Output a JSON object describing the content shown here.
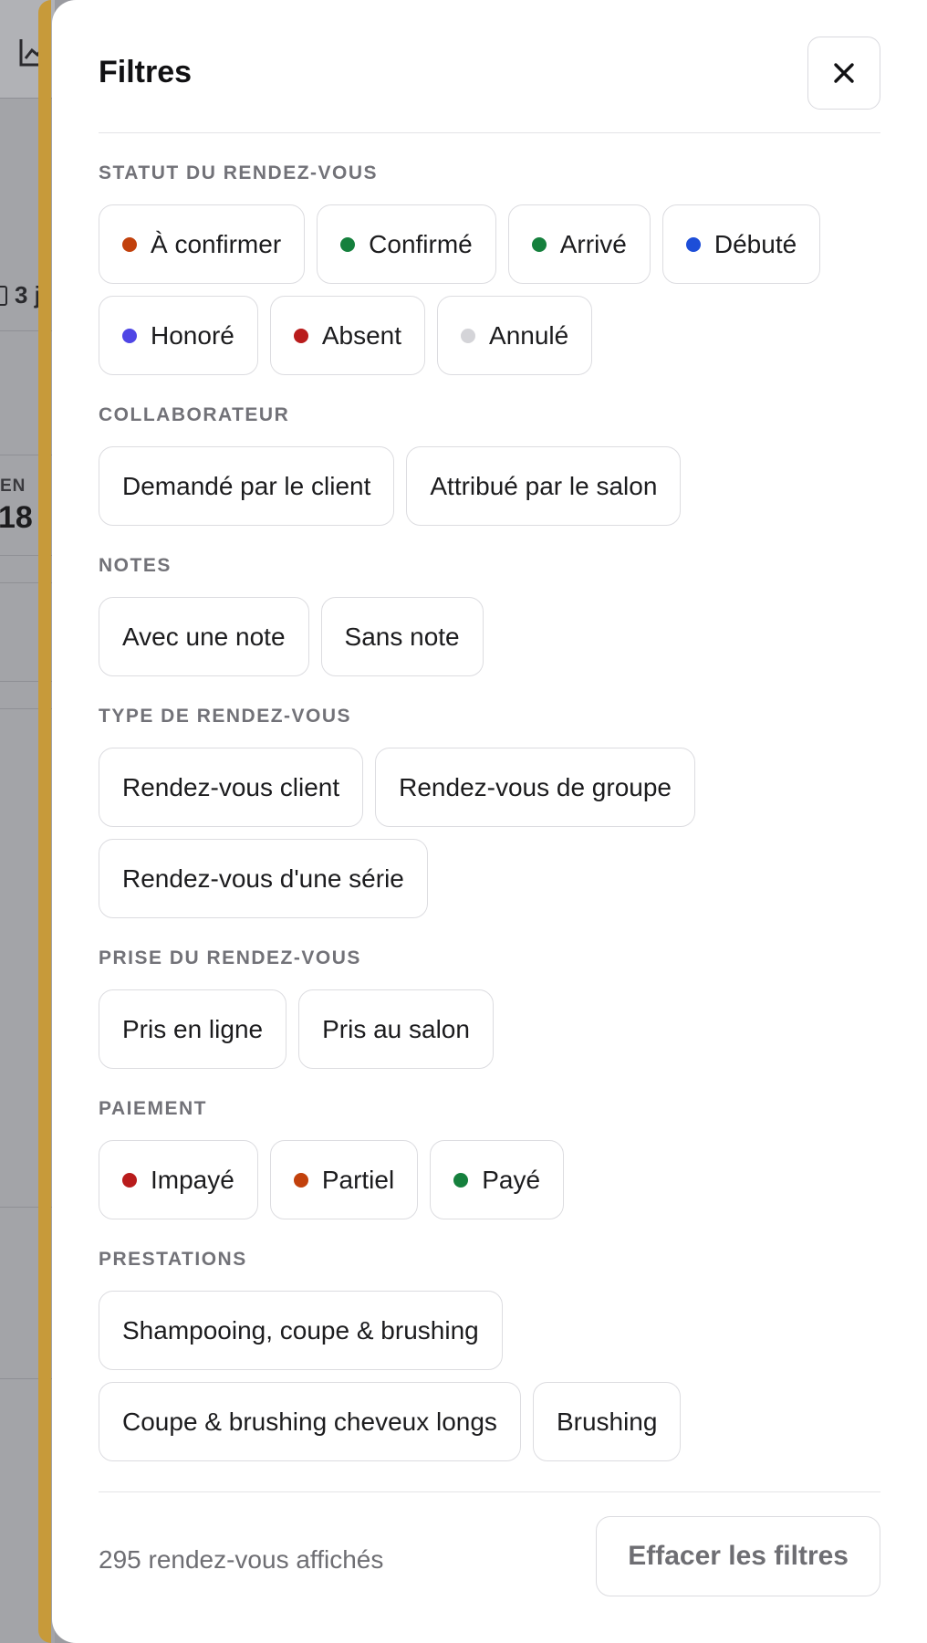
{
  "background": {
    "days_label": "3 j",
    "stat_label": "EN",
    "stat_value": "18"
  },
  "panel": {
    "title": "Filtres",
    "close_icon": "close-icon"
  },
  "sections": [
    {
      "title": "STATUT DU RENDEZ-VOUS",
      "chips": [
        {
          "label": "À confirmer",
          "dot": "#c2410c"
        },
        {
          "label": "Confirmé",
          "dot": "#15803d"
        },
        {
          "label": "Arrivé",
          "dot": "#15803d"
        },
        {
          "label": "Débuté",
          "dot": "#1d4ed8"
        },
        {
          "label": "Honoré",
          "dot": "#4f46e5"
        },
        {
          "label": "Absent",
          "dot": "#b91c1c"
        },
        {
          "label": "Annulé",
          "dot": "#d4d4d8"
        }
      ]
    },
    {
      "title": "COLLABORATEUR",
      "chips": [
        {
          "label": "Demandé par le client"
        },
        {
          "label": "Attribué par le salon"
        }
      ]
    },
    {
      "title": "NOTES",
      "chips": [
        {
          "label": "Avec une note"
        },
        {
          "label": "Sans note"
        }
      ]
    },
    {
      "title": "TYPE DE RENDEZ-VOUS",
      "chips": [
        {
          "label": "Rendez-vous client"
        },
        {
          "label": "Rendez-vous de groupe"
        },
        {
          "label": "Rendez-vous d'une série"
        }
      ]
    },
    {
      "title": "PRISE DU RENDEZ-VOUS",
      "chips": [
        {
          "label": "Pris en ligne"
        },
        {
          "label": "Pris au salon"
        }
      ]
    },
    {
      "title": "PAIEMENT",
      "chips": [
        {
          "label": "Impayé",
          "dot": "#b91c1c"
        },
        {
          "label": "Partiel",
          "dot": "#c2410c"
        },
        {
          "label": "Payé",
          "dot": "#15803d"
        }
      ]
    },
    {
      "title": "PRESTATIONS",
      "chips": [
        {
          "label": "Shampooing, coupe & brushing"
        },
        {
          "label": "Coupe & brushing cheveux longs"
        },
        {
          "label": "Brushing"
        }
      ]
    }
  ],
  "footer": {
    "count_text": "295 rendez-vous affichés",
    "clear_label": "Effacer les filtres"
  }
}
